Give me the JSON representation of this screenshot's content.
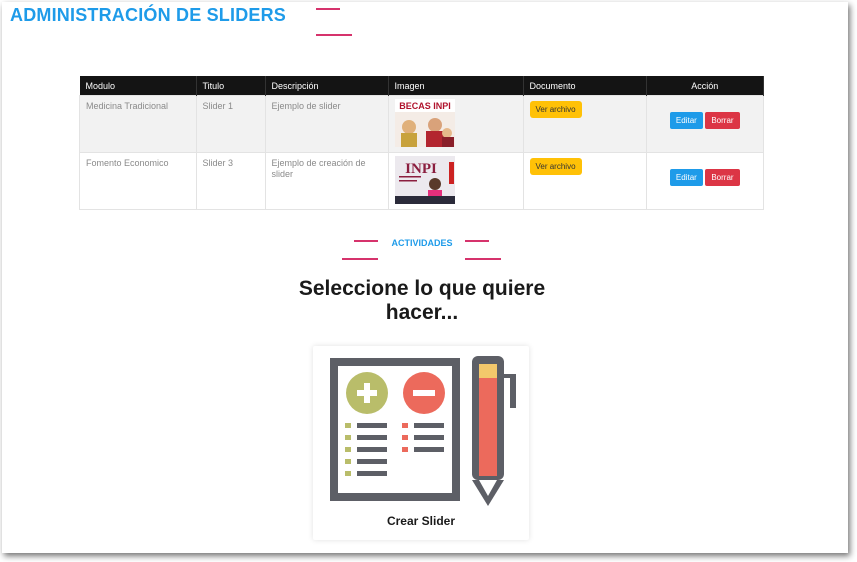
{
  "page": {
    "title": "ADMINISTRACIÓN DE SLIDERS"
  },
  "colors": {
    "accent": "#1e9be9",
    "divider": "#d6336c",
    "file_button": "#ffc107",
    "edit_button": "#1e9be9",
    "delete_button": "#dc3545"
  },
  "table": {
    "headers": [
      "Modulo",
      "Titulo",
      "Descripción",
      "Imagen",
      "Documento",
      "Acción"
    ],
    "rows": [
      {
        "modulo": "Medicina Tradicional",
        "titulo": "Slider 1",
        "descripcion": "Ejemplo de slider",
        "imagen_text": "BECAS INPI",
        "documento": "Ver archivo",
        "editar": "Editar",
        "borrar": "Borrar"
      },
      {
        "modulo": "Fomento Economico",
        "titulo": "Slider 3",
        "descripcion": "Ejemplo de creación de slider",
        "imagen_text": "INPI",
        "documento": "Ver archivo",
        "editar": "Editar",
        "borrar": "Borrar"
      }
    ]
  },
  "activities": {
    "label": "ACTIVIDADES",
    "prompt": "Seleccione lo que quiere hacer...",
    "card_label": "Crear Slider",
    "card_icon": "checklist-pen-icon"
  }
}
